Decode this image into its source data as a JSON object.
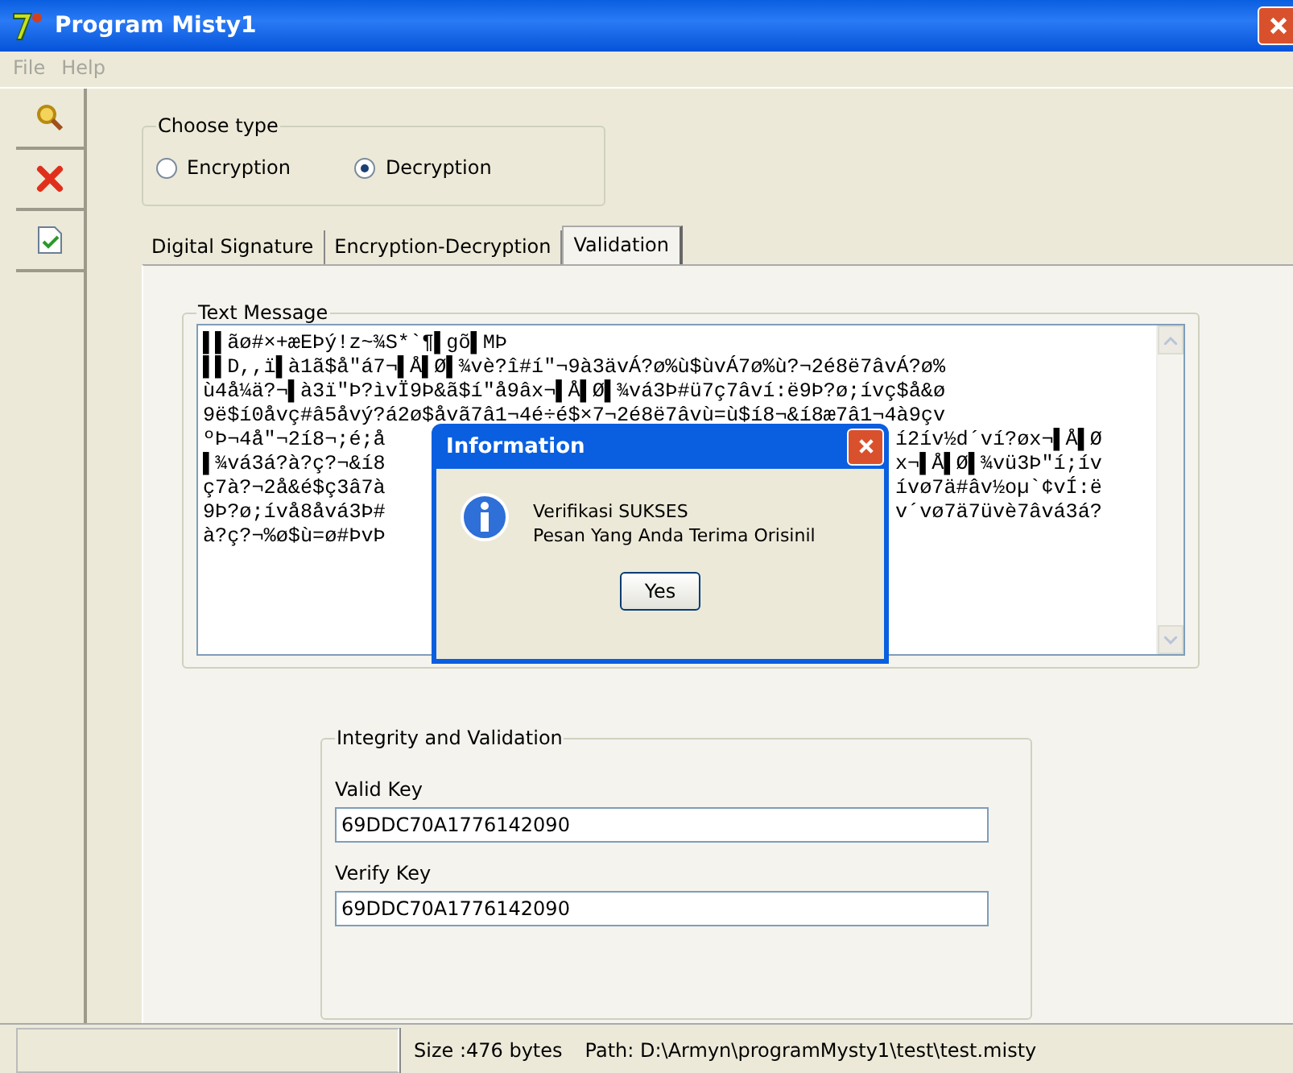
{
  "window": {
    "title": "Program Misty1"
  },
  "menu": [
    {
      "label": "File",
      "disabled": true
    },
    {
      "label": "Help",
      "disabled": true
    }
  ],
  "choose_type": {
    "title": "Choose type",
    "options": [
      {
        "label": "Encryption",
        "selected": false
      },
      {
        "label": "Decryption",
        "selected": true
      }
    ]
  },
  "tabs": [
    {
      "label": "Digital Signature",
      "selected": false
    },
    {
      "label": "Encryption-Decryption",
      "selected": false
    },
    {
      "label": "Validation",
      "selected": true
    }
  ],
  "text_message": {
    "title": "Text Message",
    "lines": [
      {
        "left": "▌▌ãø#×+æEÞý!z~¾S*`¶▌gõ▌MÞ"
      },
      {
        "left": "▌▌D,,ï▌à1ã$å\"á7¬▌Å▌Ø▌¾vè?î#í\"¬9à3ävÁ?ø%ù$ùvÁ7ø%ù?¬2é8ë7âvÁ?ø%"
      },
      {
        "left": "ù4å¼ä?¬▌à3ï\"Þ?ìvÏ9Þ&ã$í\"å9âx¬▌Å▌Ø▌¾vá3Þ#ü7ç7âví:ë9Þ?ø;ívç$å&ø"
      },
      {
        "left": "9ë$í0åvç#â5åvý?á2ø$åvã7â1¬4é÷é$×7¬2é8ë7âvù=ù$í8¬&í8æ7â1¬4à9çv"
      },
      {
        "left": "ºÞ¬4å\"¬2í8¬;é;å",
        "right": "í2ív½d´ví?øx¬▌Å▌Ø"
      },
      {
        "left": "▌¾vá3á?à?ç?¬&í8",
        "right": "x¬▌Å▌Ø▌¾vü3Þ\"í;ív"
      },
      {
        "left": "ç7à?¬2å&é$ç3â7à",
        "right": "ívø7ä#âv½oµ`¢vÍ:ë"
      },
      {
        "left": "9Þ?ø;ívå8åvá3Þ#",
        "right": "v´vø7ä7üvè7âvá3á?"
      },
      {
        "left": "à?ç?¬%ø$ù=ø#ÞvÞ"
      }
    ]
  },
  "integrity": {
    "title": "Integrity and Validation",
    "fields": [
      {
        "label": "Valid Key",
        "value": "69DDC70A1776142090"
      },
      {
        "label": "Verify Key",
        "value": "69DDC70A1776142090"
      }
    ]
  },
  "status_bar": {
    "size": "Size :476 bytes",
    "path": "Path:  D:\\Armyn\\programMysty1\\test\\test.misty"
  },
  "dialog": {
    "title": "Information",
    "messages": [
      "Verifikasi SUKSES",
      "Pesan Yang Anda Terima Orisinil"
    ],
    "button": "Yes"
  }
}
